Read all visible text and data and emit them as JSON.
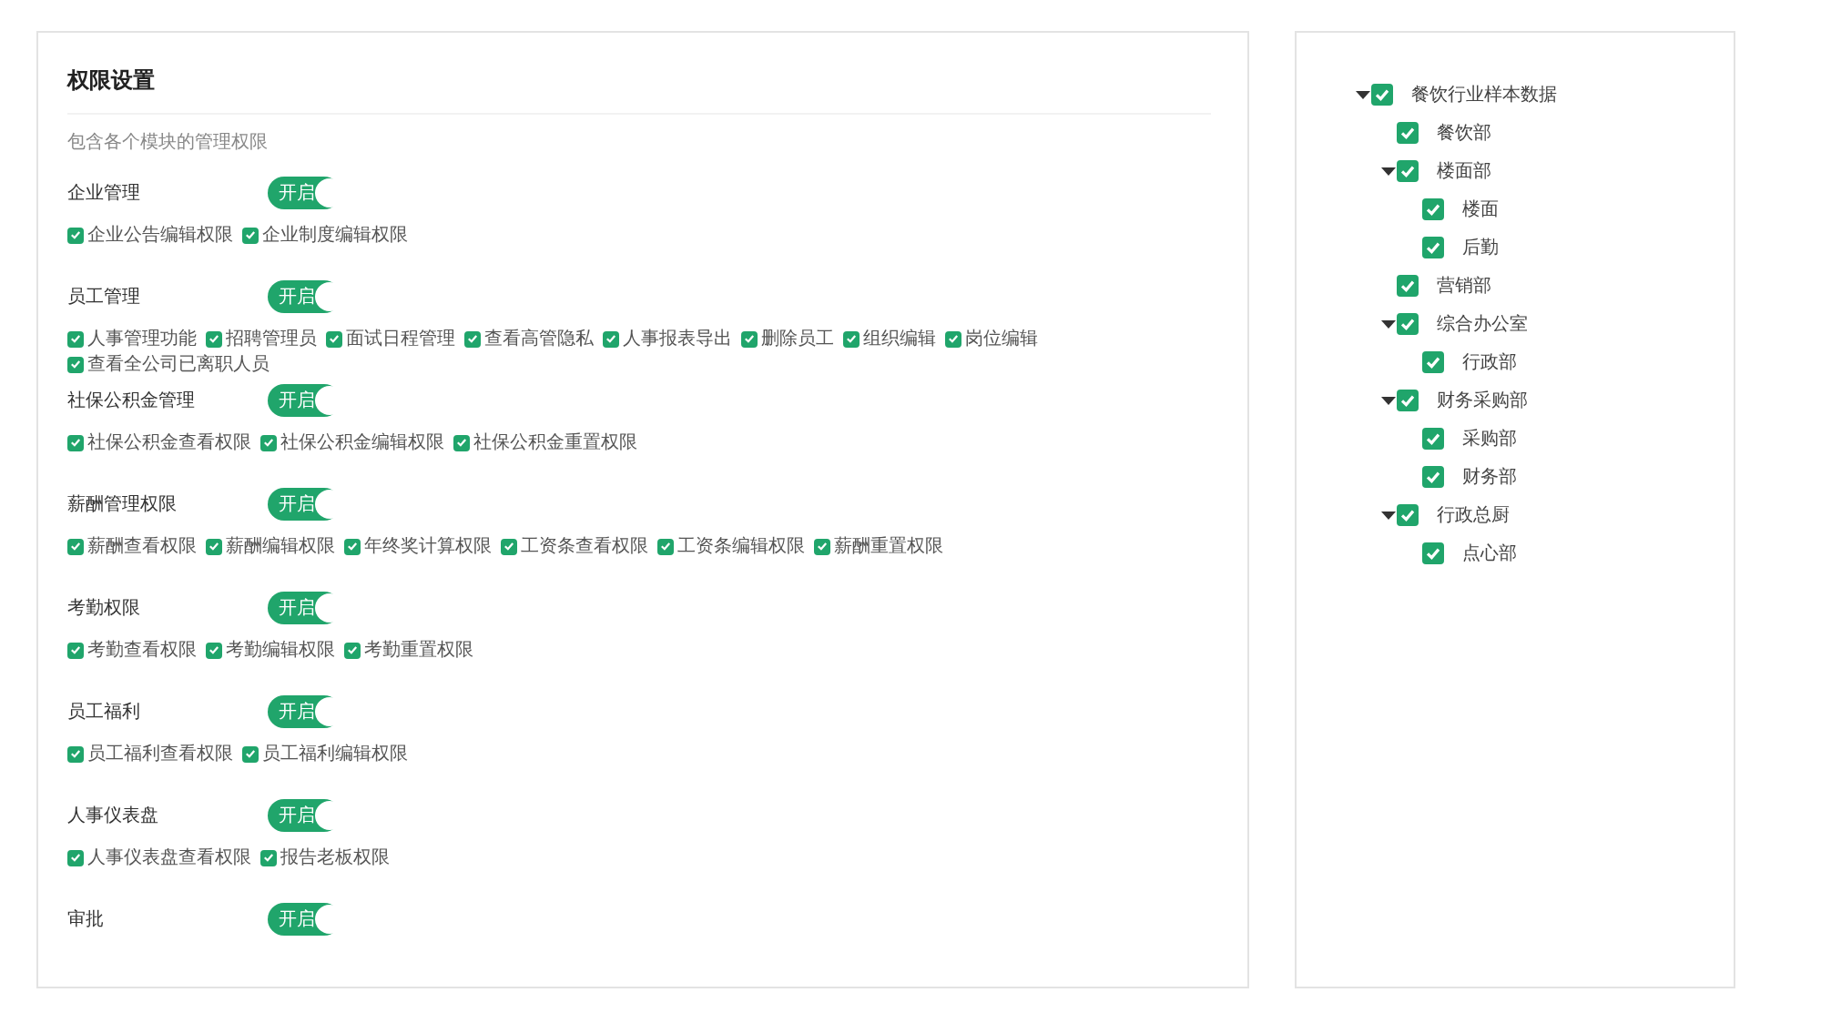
{
  "permissions_panel": {
    "title": "权限设置",
    "subtitle": "包含各个模块的管理权限",
    "modules": [
      {
        "label": "企业管理",
        "toggle": {
          "on": true,
          "text": "开启"
        },
        "permissions": [
          {
            "label": "企业公告编辑权限",
            "checked": true
          },
          {
            "label": "企业制度编辑权限",
            "checked": true
          }
        ]
      },
      {
        "label": "员工管理",
        "toggle": {
          "on": true,
          "text": "开启"
        },
        "permissions": [
          {
            "label": "人事管理功能",
            "checked": true
          },
          {
            "label": "招聘管理员",
            "checked": true
          },
          {
            "label": "面试日程管理",
            "checked": true
          },
          {
            "label": "查看高管隐私",
            "checked": true
          },
          {
            "label": "人事报表导出",
            "checked": true
          },
          {
            "label": "删除员工",
            "checked": true
          },
          {
            "label": "组织编辑",
            "checked": true
          },
          {
            "label": "岗位编辑",
            "checked": true
          },
          {
            "label": "查看全公司已离职人员",
            "checked": true
          }
        ]
      },
      {
        "label": "社保公积金管理",
        "toggle": {
          "on": true,
          "text": "开启"
        },
        "permissions": [
          {
            "label": "社保公积金查看权限",
            "checked": true
          },
          {
            "label": "社保公积金编辑权限",
            "checked": true
          },
          {
            "label": "社保公积金重置权限",
            "checked": true
          }
        ]
      },
      {
        "label": "薪酬管理权限",
        "toggle": {
          "on": true,
          "text": "开启"
        },
        "permissions": [
          {
            "label": "薪酬查看权限",
            "checked": true
          },
          {
            "label": "薪酬编辑权限",
            "checked": true
          },
          {
            "label": "年终奖计算权限",
            "checked": true
          },
          {
            "label": "工资条查看权限",
            "checked": true
          },
          {
            "label": "工资条编辑权限",
            "checked": true
          },
          {
            "label": "薪酬重置权限",
            "checked": true
          }
        ]
      },
      {
        "label": "考勤权限",
        "toggle": {
          "on": true,
          "text": "开启"
        },
        "permissions": [
          {
            "label": "考勤查看权限",
            "checked": true
          },
          {
            "label": "考勤编辑权限",
            "checked": true
          },
          {
            "label": "考勤重置权限",
            "checked": true
          }
        ]
      },
      {
        "label": "员工福利",
        "toggle": {
          "on": true,
          "text": "开启"
        },
        "permissions": [
          {
            "label": "员工福利查看权限",
            "checked": true
          },
          {
            "label": "员工福利编辑权限",
            "checked": true
          }
        ]
      },
      {
        "label": "人事仪表盘",
        "toggle": {
          "on": true,
          "text": "开启"
        },
        "permissions": [
          {
            "label": "人事仪表盘查看权限",
            "checked": true
          },
          {
            "label": "报告老板权限",
            "checked": true
          }
        ]
      },
      {
        "label": "审批",
        "toggle": {
          "on": true,
          "text": "开启"
        }
      }
    ]
  },
  "department_tree": {
    "items": [
      {
        "label": "餐饮行业样本数据",
        "checked": true,
        "expanded": true,
        "children": [
          {
            "label": "餐饮部",
            "checked": true
          },
          {
            "label": "楼面部",
            "checked": true,
            "expanded": true,
            "children": [
              {
                "label": "楼面",
                "checked": true
              },
              {
                "label": "后勤",
                "checked": true
              }
            ]
          },
          {
            "label": "营销部",
            "checked": true
          },
          {
            "label": "综合办公室",
            "checked": true,
            "expanded": true,
            "children": [
              {
                "label": "行政部",
                "checked": true
              }
            ]
          },
          {
            "label": "财务采购部",
            "checked": true,
            "expanded": true,
            "children": [
              {
                "label": "采购部",
                "checked": true
              },
              {
                "label": "财务部",
                "checked": true
              }
            ]
          },
          {
            "label": "行政总厨",
            "checked": true,
            "expanded": true,
            "children": [
              {
                "label": "点心部",
                "checked": true
              }
            ]
          }
        ]
      }
    ]
  }
}
